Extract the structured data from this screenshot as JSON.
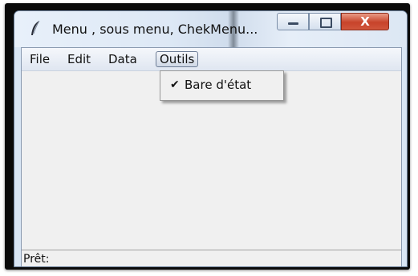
{
  "window": {
    "title": "Menu , sous menu, ChekMenu..."
  },
  "menubar": {
    "items": [
      {
        "label": "File"
      },
      {
        "label": "Edit"
      },
      {
        "label": "Data"
      },
      {
        "label": "Outils"
      }
    ],
    "active_item": "Outils"
  },
  "dropdown": {
    "items": [
      {
        "label": "Bare d'état",
        "checked": true
      }
    ]
  },
  "statusbar": {
    "text": "Prêt:"
  },
  "icons": {
    "app": "feather-icon",
    "minimize": "minimize-icon",
    "maximize": "maximize-icon",
    "close": "close-icon",
    "check": "checkmark-icon"
  },
  "colors": {
    "close_button": "#c7432a",
    "titlebar": "#dde8f5",
    "client_bg": "#f0f0f0"
  }
}
